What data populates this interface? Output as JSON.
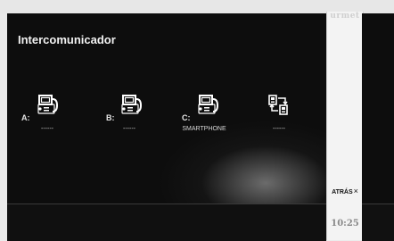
{
  "screen": {
    "title": "Intercomunicador"
  },
  "options": [
    {
      "letter": "A:",
      "icon": "intercom-device-icon",
      "label": "------"
    },
    {
      "letter": "B:",
      "icon": "intercom-device-icon",
      "label": "------"
    },
    {
      "letter": "C:",
      "icon": "intercom-device-icon",
      "label": "SMARTPHONE"
    },
    {
      "letter": "",
      "icon": "transfer-devices-icon",
      "label": "------"
    }
  ],
  "side": {
    "brand": "urmet",
    "back_label": "ATRÁS",
    "back_icon": "×",
    "time": "10:25"
  },
  "colors": {
    "panel": "#0d0d0d",
    "strip": "#f3f3f3",
    "text": "#f2f2f2"
  }
}
